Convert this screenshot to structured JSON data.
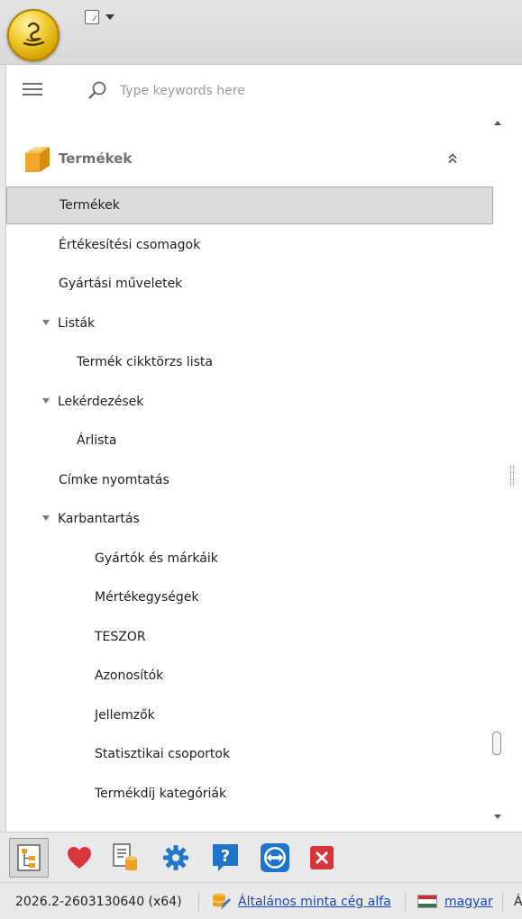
{
  "search": {
    "placeholder": "Type keywords here"
  },
  "group": {
    "title": "Termékek"
  },
  "tree": [
    {
      "label": "Termékek",
      "level": 1,
      "selected": true,
      "expander": false
    },
    {
      "label": "Értékesítési csomagok",
      "level": 1,
      "selected": false,
      "expander": false
    },
    {
      "label": "Gyártási műveletek",
      "level": 1,
      "selected": false,
      "expander": false
    },
    {
      "label": "Listák",
      "level": 0,
      "selected": false,
      "expander": true
    },
    {
      "label": "Termék cikktörzs lista",
      "level": 2,
      "selected": false,
      "expander": false
    },
    {
      "label": "Lekérdezések",
      "level": 0,
      "selected": false,
      "expander": true
    },
    {
      "label": "Árlista",
      "level": 2,
      "selected": false,
      "expander": false
    },
    {
      "label": "Címke nyomtatás",
      "level": 1,
      "selected": false,
      "expander": false
    },
    {
      "label": "Karbantartás",
      "level": 0,
      "selected": false,
      "expander": true
    },
    {
      "label": "Gyártók és márkáik",
      "level": 3,
      "selected": false,
      "expander": false
    },
    {
      "label": "Mértékegységek",
      "level": 3,
      "selected": false,
      "expander": false
    },
    {
      "label": "TESZOR",
      "level": 3,
      "selected": false,
      "expander": false
    },
    {
      "label": "Azonosítók",
      "level": 3,
      "selected": false,
      "expander": false
    },
    {
      "label": "Jellemzők",
      "level": 3,
      "selected": false,
      "expander": false
    },
    {
      "label": "Statisztikai csoportok",
      "level": 3,
      "selected": false,
      "expander": false
    },
    {
      "label": "Termékdíj kategóriák",
      "level": 3,
      "selected": false,
      "expander": false
    }
  ],
  "toolbar": {
    "buttons": [
      "tree-view-icon",
      "heart-icon",
      "document-database-icon",
      "gear-icon",
      "help-icon",
      "teamviewer-icon",
      "close-icon"
    ]
  },
  "status": {
    "version": "2026.2-2603130640 (x64)",
    "company": "Általános minta cég alfa",
    "language": "magyar",
    "cut_text": "Á"
  },
  "colors": {
    "accent_blue": "#1e74c8",
    "heart_red": "#d9353f",
    "close_red": "#d8343e",
    "link_blue": "#1a48b8"
  }
}
